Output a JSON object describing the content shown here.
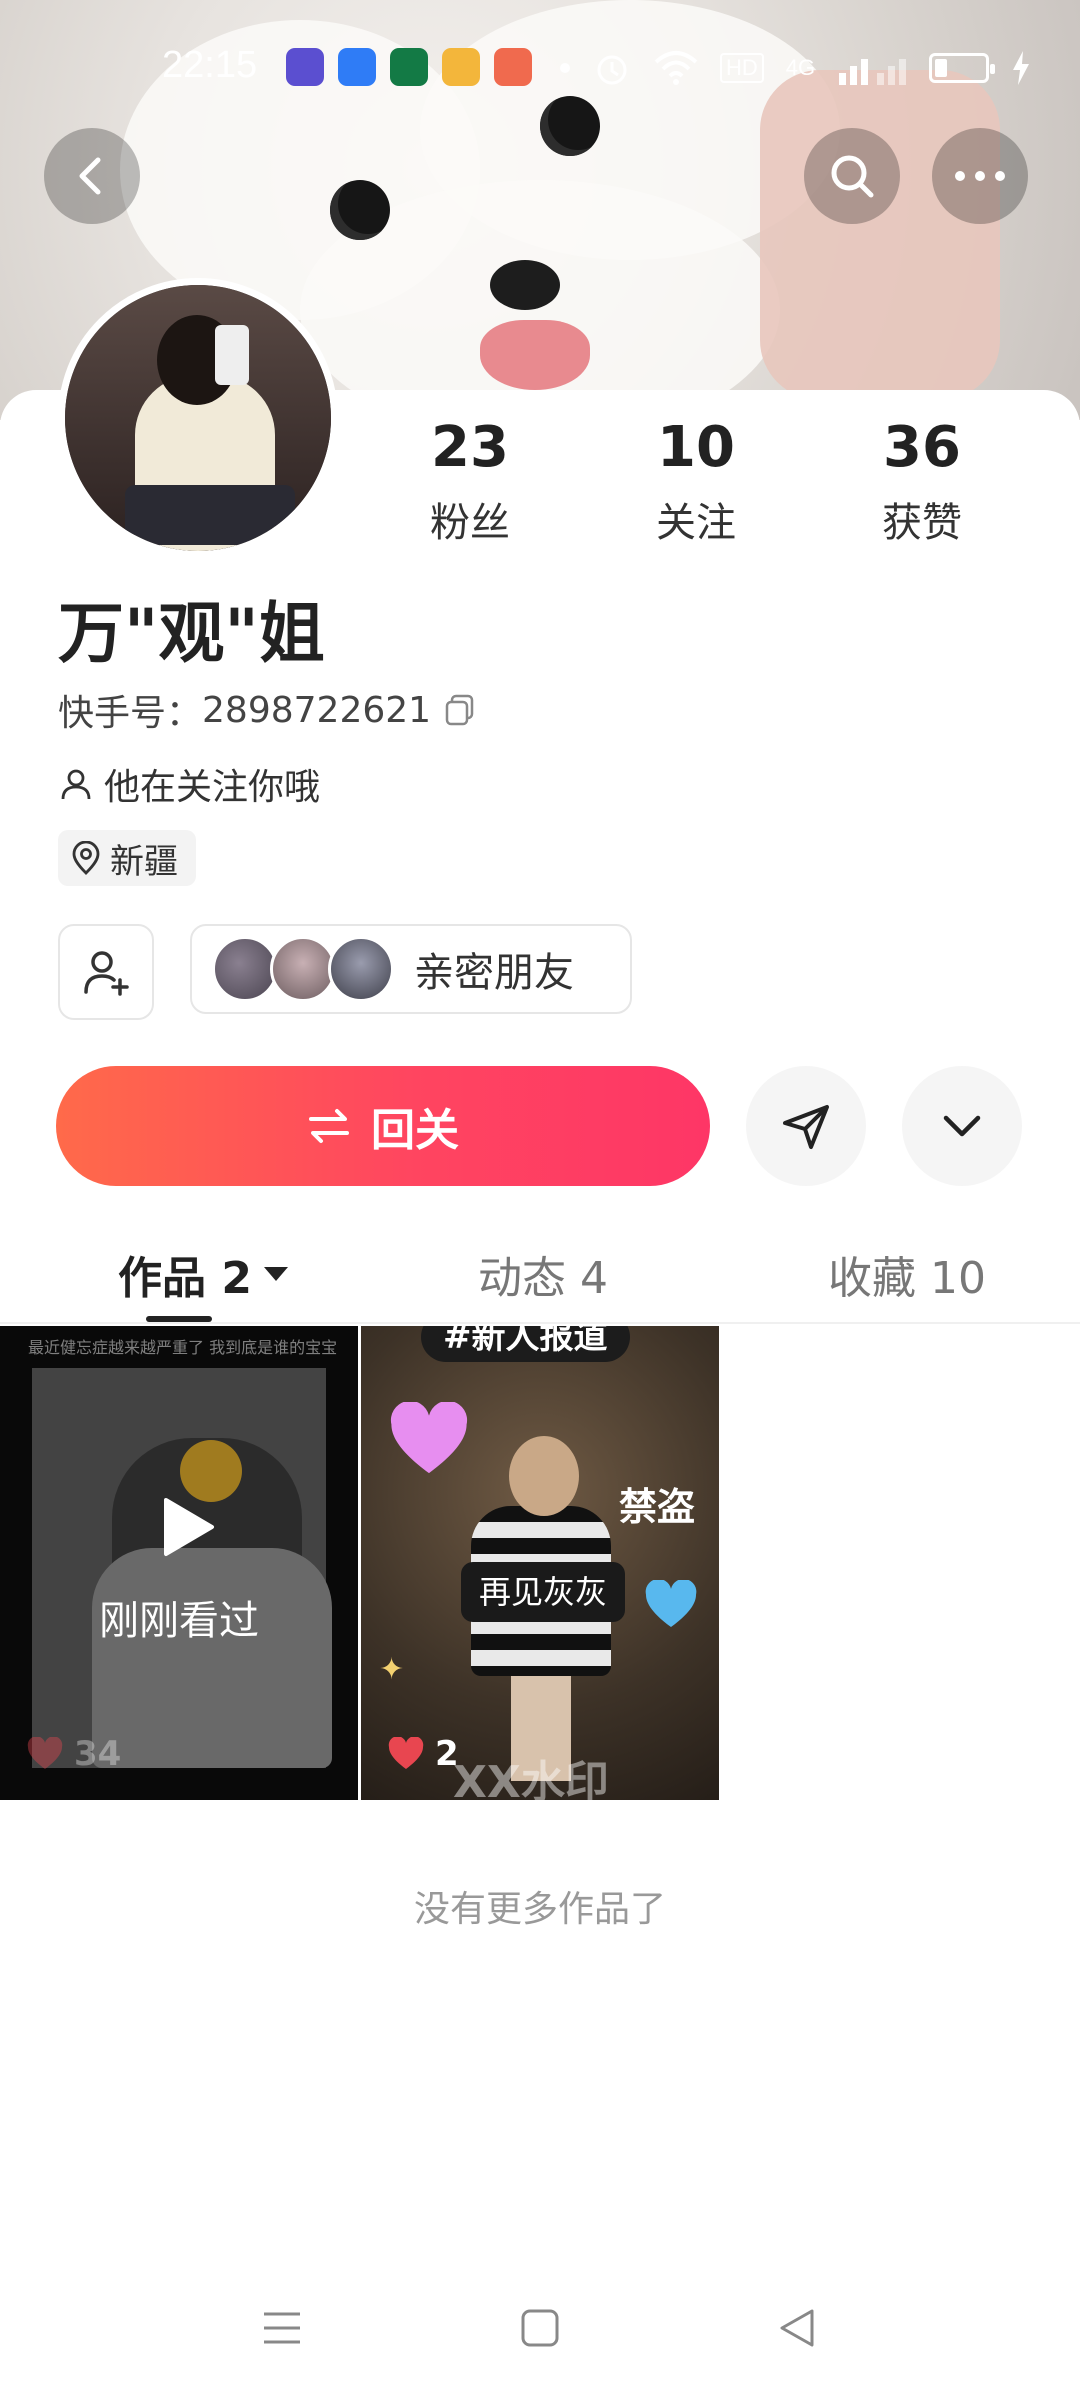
{
  "status_bar": {
    "time": "22:15",
    "app_icons": [
      {
        "name": "app-icon-1",
        "color": "#5b4fd0"
      },
      {
        "name": "app-icon-2",
        "color": "#2f7cf6"
      },
      {
        "name": "app-icon-3",
        "color": "#137a45"
      },
      {
        "name": "app-icon-4",
        "color": "#f3b63b"
      },
      {
        "name": "app-icon-5",
        "color": "#f06a4e"
      }
    ],
    "network_label": "HD",
    "signal_label": "4G"
  },
  "profile": {
    "nickname": "万\"观\"姐",
    "kuaishou_id_label": "快手号：",
    "kuaishou_id": "2898722621",
    "follows_you_text": "他在关注你哦",
    "location": "新疆",
    "stats": [
      {
        "value": "23",
        "label": "粉丝"
      },
      {
        "value": "10",
        "label": "关注"
      },
      {
        "value": "36",
        "label": "获赞"
      }
    ]
  },
  "close_friends": {
    "label": "亲密朋友",
    "avatars": [
      "#4a4450",
      "#6d5d60",
      "#3e3f4a"
    ]
  },
  "actions": {
    "follow_back_label": "回关",
    "follow_back_gradient": [
      "#ff6a4a",
      "#fe3666"
    ]
  },
  "tabs": [
    {
      "label": "作品 2",
      "active": true
    },
    {
      "label": "动态 4",
      "active": false
    },
    {
      "label": "收藏 10",
      "active": false
    }
  ],
  "works": [
    {
      "caption_top": "最近健忘症越来越严重了 我到底是谁的宝宝",
      "overlay_label": "刚刚看过",
      "likes": "34"
    },
    {
      "tag": "#新人报道",
      "stamp": "禁盗",
      "center_label": "再见灰灰",
      "watermark": "XX水印",
      "likes": "2"
    }
  ],
  "no_more_text": "没有更多作品了",
  "colors": {
    "accent": "#fe3666",
    "like_red": "#e84650"
  }
}
